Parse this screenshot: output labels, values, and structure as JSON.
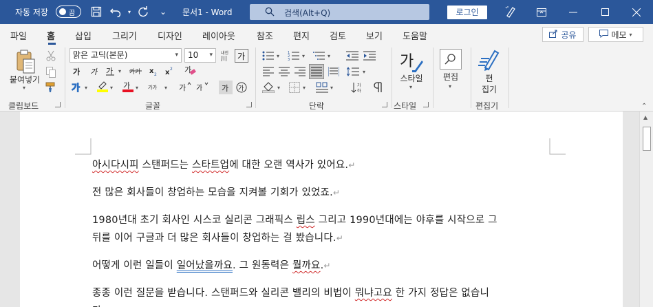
{
  "titlebar": {
    "autosave_label": "자동 저장",
    "autosave_toggle": "끔",
    "doc_title": "문서1  -  Word",
    "search_placeholder": "검색(Alt+Q)",
    "login_label": "로그인"
  },
  "tabs": [
    {
      "label": "파일"
    },
    {
      "label": "홈"
    },
    {
      "label": "삽입"
    },
    {
      "label": "그리기"
    },
    {
      "label": "디자인"
    },
    {
      "label": "레이아웃"
    },
    {
      "label": "참조"
    },
    {
      "label": "편지"
    },
    {
      "label": "검토"
    },
    {
      "label": "보기"
    },
    {
      "label": "도움말"
    }
  ],
  "tab_actions": {
    "share_label": "공유",
    "memo_label": "메모"
  },
  "ribbon": {
    "clipboard": {
      "paste_label": "붙여넣기",
      "group_label": "클립보드"
    },
    "font": {
      "font_name": "맑은 고딕(본문)",
      "font_size": "10",
      "group_label": "글꼴"
    },
    "paragraph": {
      "group_label": "단락"
    },
    "styles": {
      "styles_label": "스타일",
      "group_label": "스타일"
    },
    "editing": {
      "editing_label": "편집",
      "editor_label_1": "편",
      "editor_label_2": "집기",
      "group_label": "편집기"
    }
  },
  "document": {
    "paragraphs": [
      {
        "segments": [
          {
            "text": "아시다시피",
            "style": "squig"
          },
          {
            "text": " 스탠퍼드는 ",
            "style": ""
          },
          {
            "text": "스타트업",
            "style": "squig"
          },
          {
            "text": "에 대한 오랜 역사가 있어요.",
            "style": ""
          }
        ]
      },
      {
        "segments": [
          {
            "text": "전 많은 회사들이 창업하는 모습을 지켜볼 기회가 있었죠.",
            "style": ""
          }
        ]
      },
      {
        "segments": [
          {
            "text": "1980년대 초기 회사인 시스코 실리콘 그래픽스 ",
            "style": ""
          },
          {
            "text": "립스",
            "style": "squig"
          },
          {
            "text": " 그리고 1990년대에는 야후를 시작으로 그",
            "style": ""
          }
        ]
      },
      {
        "segments": [
          {
            "text": "뒤를 이어 구글과 더 많은 회사들이 창업하는 걸 봤습니다.",
            "style": ""
          }
        ]
      },
      {
        "segments": [
          {
            "text": "어떻게 이런 일들이 ",
            "style": ""
          },
          {
            "text": "일어났을까요",
            "style": "squig-blue"
          },
          {
            "text": ". 그 원동력은 ",
            "style": ""
          },
          {
            "text": "뭘까요",
            "style": "squig"
          },
          {
            "text": ".",
            "style": ""
          }
        ]
      },
      {
        "segments": [
          {
            "text": "종종 이런 질문을 받습니다. 스탠퍼드와 실리콘 밸리의 비법이 ",
            "style": ""
          },
          {
            "text": "뭐냐고요",
            "style": "squig"
          },
          {
            "text": " 한 가지 정답은 없습니",
            "style": ""
          }
        ]
      },
      {
        "segments": [
          {
            "text": "다.",
            "style": ""
          }
        ]
      }
    ],
    "paragraph_mark": "↵"
  },
  "colors": {
    "titlebar": "#2b579a",
    "ribbon": "#f3f3f3",
    "highlight_yellow": "#ffff00",
    "font_color_red": "#e81123",
    "spell_red": "#d12d2d"
  }
}
